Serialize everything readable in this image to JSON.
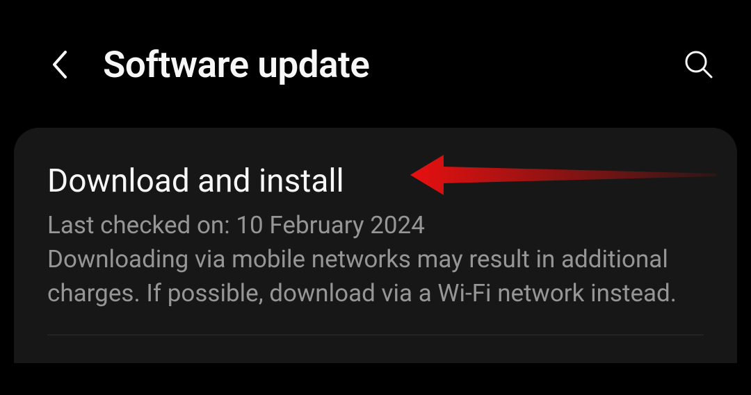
{
  "header": {
    "title": "Software update"
  },
  "card": {
    "title": "Download and install",
    "lastChecked": "Last checked on: 10 February 2024",
    "description": "Downloading via mobile networks may result in additional charges. If possible, download via a Wi-Fi network instead."
  }
}
